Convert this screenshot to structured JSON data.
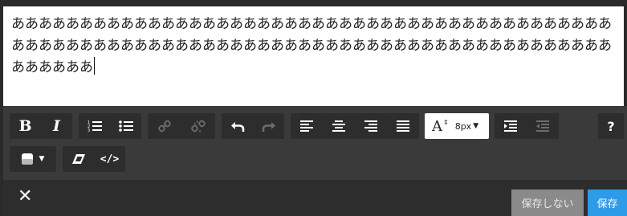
{
  "editor": {
    "text": "ああああああああああああああああああああああああああああああああああああああああああああああああああああああああああああああああああああああああああああああああああああああああああああああ"
  },
  "toolbar": {
    "bold_label": "B",
    "italic_label": "I",
    "font_size": {
      "glyph": "A",
      "value": "8px"
    },
    "help_label": "?"
  },
  "footer": {
    "close_label": "✕",
    "nosave_label": "保存しない",
    "save_label": "保存"
  },
  "colors": {
    "toolbar_bg": "#3a3a3a",
    "group_bg": "#2d2d2d",
    "save_blue": "#2e9be8",
    "nosave_gray": "#8a8a8a"
  },
  "icons": [
    "bold-icon",
    "italic-icon",
    "ordered-list-icon",
    "unordered-list-icon",
    "link-icon",
    "unlink-icon",
    "undo-icon",
    "redo-icon",
    "align-left-icon",
    "align-center-icon",
    "align-right-icon",
    "align-justify-icon",
    "font-size-icon",
    "indent-icon",
    "outdent-icon",
    "help-icon",
    "color-swatch-icon",
    "eraser-icon",
    "code-icon",
    "close-icon"
  ]
}
